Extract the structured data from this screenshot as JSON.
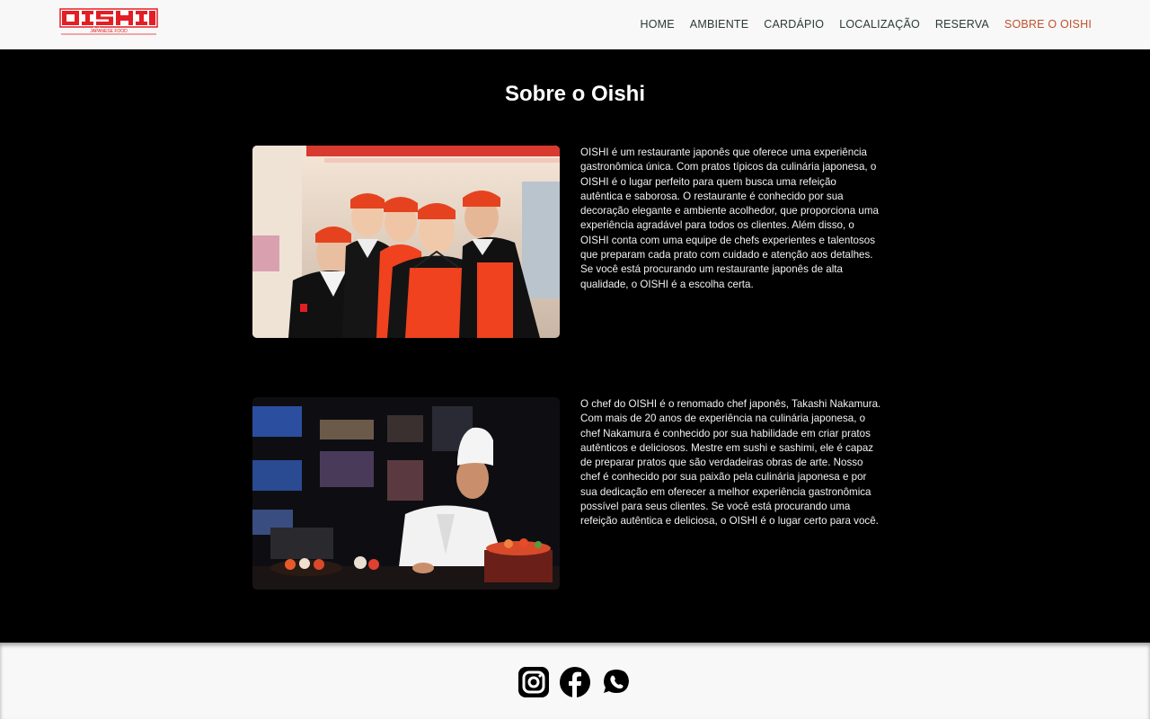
{
  "brand": {
    "logo_text": "OISHI",
    "logo_subtitle": "JAPANESE FOOD",
    "accent_color": "#e31e24"
  },
  "nav": {
    "items": [
      {
        "label": "HOME",
        "active": false
      },
      {
        "label": "AMBIENTE",
        "active": false
      },
      {
        "label": "CARDÁPIO",
        "active": false
      },
      {
        "label": "LOCALIZAÇÃO",
        "active": false
      },
      {
        "label": "RESERVA",
        "active": false
      },
      {
        "label": "SOBRE O OISHI",
        "active": true
      }
    ],
    "active_color": "#c0522e"
  },
  "main": {
    "title": "Sobre o Oishi",
    "sections": [
      {
        "image": "staff-team-photo",
        "text": "OISHI é um restaurante japonês que oferece uma experiência gastronômica única. Com pratos típicos da culinária japonesa, o OISHI é o lugar perfeito para quem busca uma refeição autêntica e saborosa. O restaurante é conhecido por sua decoração elegante e ambiente acolhedor, que proporciona uma experiência agradável para todos os clientes. Além disso, o OISHI conta com uma equipe de chefs experientes e talentosos que preparam cada prato com cuidado e atenção aos detalhes. Se você está procurando um restaurante japonês de alta qualidade, o OISHI é a escolha certa."
      },
      {
        "image": "chef-preparing-sushi-photo",
        "text": "O chef do OISHI é o renomado chef japonês, Takashi Nakamura. Com mais de 20 anos de experiência na culinária japonesa, o chef Nakamura é conhecido por sua habilidade em criar pratos autênticos e deliciosos. Mestre em sushi e sashimi, ele é capaz de preparar pratos que são verdadeiras obras de arte. Nosso chef é conhecido por sua paixão pela culinária japonesa e por sua dedicação em oferecer a melhor experiência gastronômica possível para seus clientes. Se você está procurando uma refeição autêntica e deliciosa, o OISHI é o lugar certo para você."
      }
    ]
  },
  "footer": {
    "social": [
      {
        "name": "instagram-icon"
      },
      {
        "name": "facebook-icon"
      },
      {
        "name": "whatsapp-icon"
      }
    ]
  }
}
